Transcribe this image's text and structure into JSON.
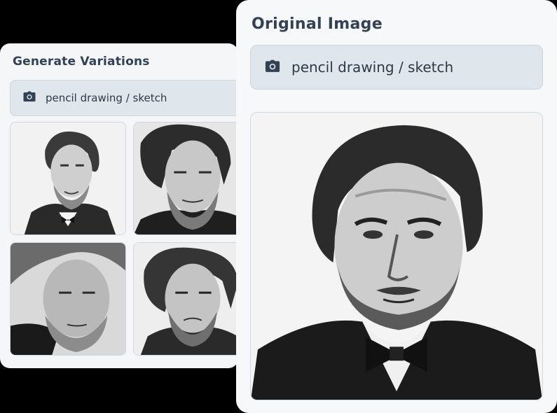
{
  "variations_panel": {
    "title": "Generate Variations",
    "prompt": {
      "icon": "camera-icon",
      "text": "pencil drawing / sketch"
    },
    "thumbnails": [
      {
        "alt": "variation-1"
      },
      {
        "alt": "variation-2"
      },
      {
        "alt": "variation-3"
      },
      {
        "alt": "variation-4"
      }
    ]
  },
  "original_panel": {
    "title": "Original Image",
    "prompt": {
      "icon": "camera-icon",
      "text": "pencil drawing / sketch"
    }
  },
  "colors": {
    "card_bg": "#f4f6f8",
    "prompt_bg": "#dfe6ec",
    "title_text": "#334155"
  }
}
